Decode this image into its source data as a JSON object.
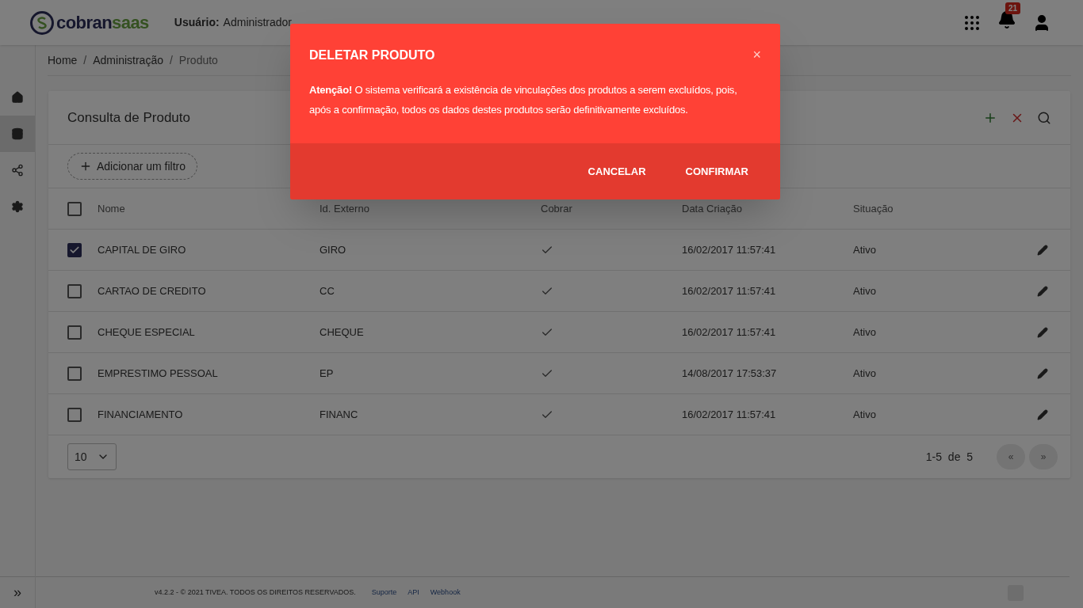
{
  "header": {
    "logo": {
      "part1": "cobran",
      "part2": "saas"
    },
    "user_label": "Usuário:",
    "user_value": "Administrador",
    "notifications_count": "21"
  },
  "sidebar": {
    "items": [
      {
        "selected": false
      },
      {
        "selected": true
      },
      {
        "selected": false
      },
      {
        "selected": false
      }
    ],
    "expand": "»"
  },
  "breadcrumb": {
    "separator": "/",
    "items": [
      "Home",
      "Administração",
      "Produto"
    ]
  },
  "card": {
    "title": "Consulta de Produto",
    "filter_button": "Adicionar um filtro",
    "table": {
      "columns": [
        "Nome",
        "Id. Externo",
        "Cobrar",
        "Data Criação",
        "Situação"
      ],
      "header_checked": false,
      "rows": [
        {
          "checked": true,
          "nome": "CAPITAL DE GIRO",
          "id_externo": "GIRO",
          "cobrar": true,
          "data": "16/02/2017 11:57:41",
          "situacao": "Ativo"
        },
        {
          "checked": false,
          "nome": "CARTAO DE CREDITO",
          "id_externo": "CC",
          "cobrar": true,
          "data": "16/02/2017 11:57:41",
          "situacao": "Ativo"
        },
        {
          "checked": false,
          "nome": "CHEQUE ESPECIAL",
          "id_externo": "CHEQUE",
          "cobrar": true,
          "data": "16/02/2017 11:57:41",
          "situacao": "Ativo"
        },
        {
          "checked": false,
          "nome": "EMPRESTIMO PESSOAL",
          "id_externo": "EP",
          "cobrar": true,
          "data": "14/08/2017 17:53:37",
          "situacao": "Ativo"
        },
        {
          "checked": false,
          "nome": "FINANCIAMENTO",
          "id_externo": "FINANC",
          "cobrar": true,
          "data": "16/02/2017 11:57:41",
          "situacao": "Ativo"
        }
      ]
    },
    "page_size": "10",
    "range": "1-5",
    "range_of": "de",
    "total": "5",
    "prev": "«",
    "next": "»"
  },
  "footer": {
    "copyright": "v4.2.2 - © 2021 TIVEA. TODOS OS DIREITOS RESERVADOS.",
    "links": [
      "Suporte",
      "API",
      "Webhook"
    ]
  },
  "dialog": {
    "title": "DELETAR PRODUTO",
    "close": "×",
    "message": "**Atenção!** O sistema verificará a existência de vinculações dos produtos a serem excluídos, pois, após a confirmação, todos os dados destes produtos serão definitivamente excluídos.",
    "buttons": [
      "CANCELAR",
      "CONFIRMAR"
    ]
  }
}
